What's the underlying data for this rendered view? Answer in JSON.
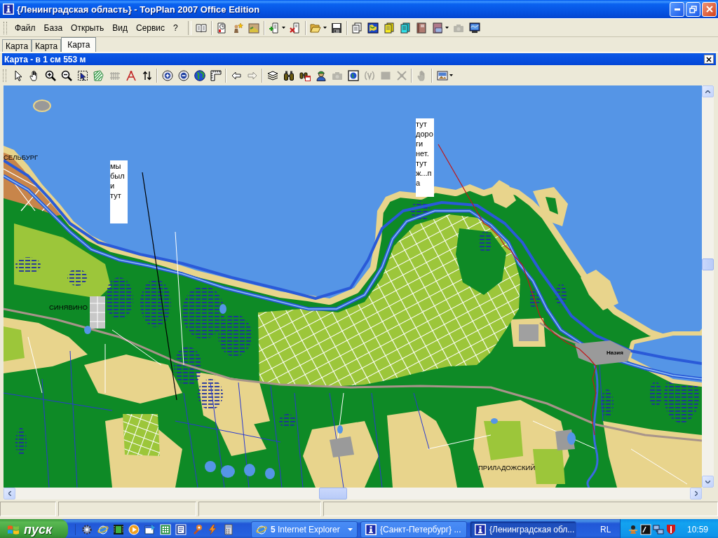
{
  "window": {
    "title": "{Ленинградская область} - TopPlan 2007 Office Edition"
  },
  "menu": [
    "Файл",
    "База",
    "Открыть",
    "Вид",
    "Сервис",
    "?"
  ],
  "main_toolbar": [
    {
      "kind": "book",
      "disabled": false
    },
    {
      "kind": "separator"
    },
    {
      "kind": "report",
      "disabled": false
    },
    {
      "kind": "wizard",
      "disabled": false
    },
    {
      "kind": "mapfolder",
      "disabled": false
    },
    {
      "kind": "separator"
    },
    {
      "kind": "add",
      "disabled": false,
      "menu": true
    },
    {
      "kind": "remove",
      "disabled": false
    },
    {
      "kind": "separator"
    },
    {
      "kind": "open",
      "disabled": false,
      "menu": true
    },
    {
      "kind": "save",
      "disabled": false
    },
    {
      "kind": "separator"
    },
    {
      "kind": "pages",
      "disabled": false
    },
    {
      "kind": "map",
      "disabled": false
    },
    {
      "kind": "note",
      "disabled": false
    },
    {
      "kind": "card",
      "disabled": false
    },
    {
      "kind": "notebook",
      "disabled": false
    },
    {
      "kind": "listbook",
      "disabled": false,
      "menu": true
    },
    {
      "kind": "camera",
      "disabled": true
    },
    {
      "kind": "gps",
      "disabled": false
    }
  ],
  "tabs": [
    {
      "label": "Карта",
      "selected": false
    },
    {
      "label": "Карта",
      "selected": false
    },
    {
      "label": "Карта",
      "selected": true
    }
  ],
  "map_window": {
    "title": "Карта - в 1 см 553 м"
  },
  "map_toolbar": [
    {
      "kind": "pointer",
      "disabled": false
    },
    {
      "kind": "hand",
      "disabled": false
    },
    {
      "kind": "zoomin",
      "disabled": false
    },
    {
      "kind": "zoomout",
      "disabled": false
    },
    {
      "kind": "select",
      "disabled": false
    },
    {
      "kind": "hatch",
      "disabled": false
    },
    {
      "kind": "fence",
      "disabled": true
    },
    {
      "kind": "compass",
      "disabled": false
    },
    {
      "kind": "updown",
      "disabled": false
    },
    {
      "kind": "separator"
    },
    {
      "kind": "plus",
      "disabled": false
    },
    {
      "kind": "minus",
      "disabled": false
    },
    {
      "kind": "globe",
      "disabled": false
    },
    {
      "kind": "ruler",
      "disabled": false
    },
    {
      "kind": "separator"
    },
    {
      "kind": "back",
      "disabled": false
    },
    {
      "kind": "forward",
      "disabled": true
    },
    {
      "kind": "separator"
    },
    {
      "kind": "layers",
      "disabled": false
    },
    {
      "kind": "binoculars",
      "disabled": false
    },
    {
      "kind": "bincal",
      "disabled": false
    },
    {
      "kind": "person",
      "disabled": false
    },
    {
      "kind": "camera",
      "disabled": true
    },
    {
      "kind": "mapframe",
      "disabled": false
    },
    {
      "kind": "brackets",
      "disabled": true
    },
    {
      "kind": "square",
      "disabled": true
    },
    {
      "kind": "satellite",
      "disabled": true
    },
    {
      "kind": "separator"
    },
    {
      "kind": "grab",
      "disabled": true
    },
    {
      "kind": "separator"
    },
    {
      "kind": "picture",
      "disabled": false,
      "menu": true
    }
  ],
  "map": {
    "notes": [
      {
        "lines": [
          "тут",
          "доро",
          "ги",
          "нет.",
          "тут",
          "ж...п",
          "а"
        ]
      },
      {
        "lines": [
          "мы",
          "был",
          "и",
          "тут"
        ]
      }
    ],
    "place_labels": [
      {
        "text": "СЕЛЬБУРГ",
        "kind": "town"
      },
      {
        "text": "СИНЯВИНО",
        "kind": "town"
      },
      {
        "text": "Назия",
        "kind": "village"
      },
      {
        "text": "ПРИЛАДОЖСКИЙ",
        "kind": "town"
      }
    ]
  },
  "taskbar": {
    "start": "пуск",
    "buttons": [
      {
        "kind": "group",
        "label": "**5** Internet Explorer",
        "selected": false
      },
      {
        "kind": "window",
        "label": "{Санкт-Петербург} ...",
        "selected": false
      },
      {
        "kind": "window",
        "label": "{Ленинградская обл...",
        "selected": true
      }
    ],
    "language": "RL",
    "clock": "10:59"
  }
}
